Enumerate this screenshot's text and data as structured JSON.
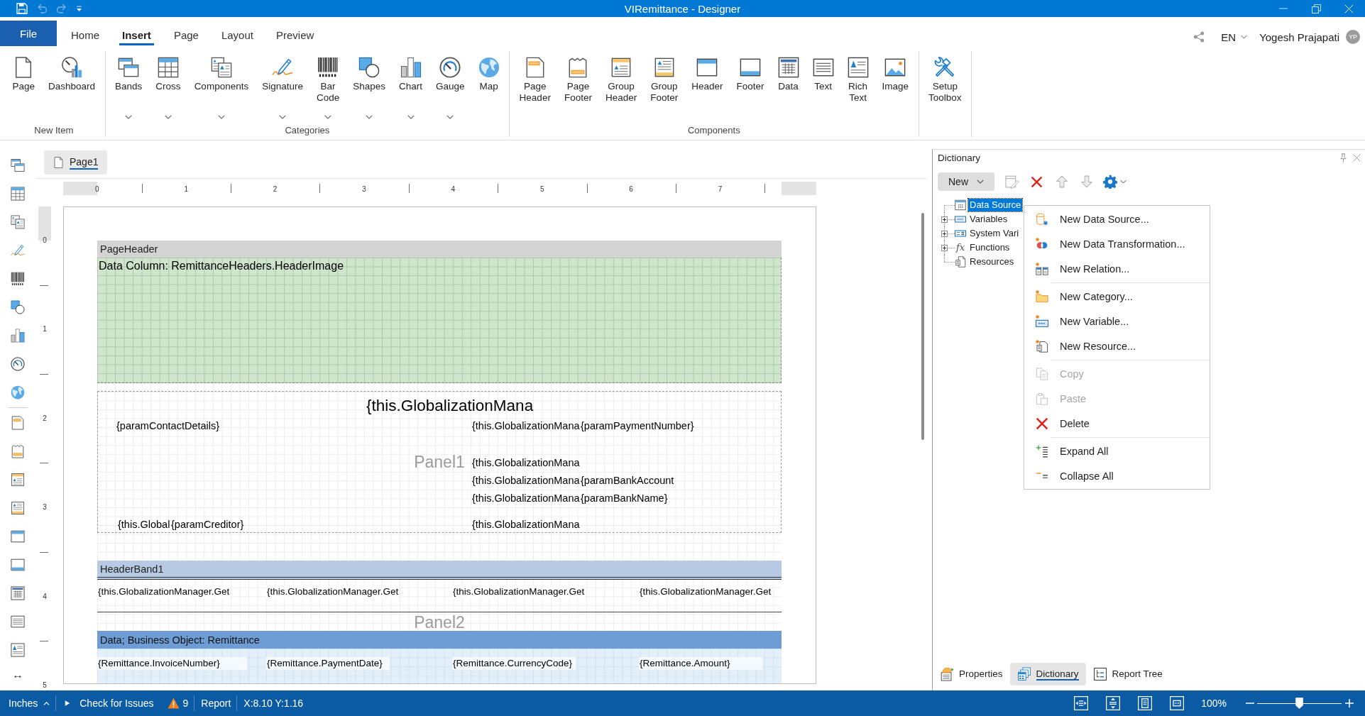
{
  "window": {
    "title": "VIRemittance - Designer",
    "quick_access": [
      {
        "disabled": false
      },
      {
        "disabled": true
      },
      {
        "disabled": true
      }
    ]
  },
  "ribbon": {
    "file_label": "File",
    "tabs": [
      {
        "label": "Home",
        "selected": false
      },
      {
        "label": "Insert",
        "selected": true
      },
      {
        "label": "Page",
        "selected": false
      },
      {
        "label": "Layout",
        "selected": false
      },
      {
        "label": "Preview",
        "selected": false
      }
    ],
    "language": "EN",
    "user": "Yogesh Prajapati",
    "avatar": "YP",
    "groups": [
      {
        "label": "New Item",
        "items": [
          {
            "label": "Page",
            "dropdown": false
          },
          {
            "label": "Dashboard",
            "dropdown": false
          }
        ]
      },
      {
        "label": "Categories",
        "items": [
          {
            "label": "Bands",
            "dropdown": true
          },
          {
            "label": "Cross",
            "dropdown": true
          },
          {
            "label": "Components",
            "dropdown": true
          },
          {
            "label": "Signature",
            "dropdown": true
          },
          {
            "label": "Bar Code",
            "dropdown": true
          },
          {
            "label": "Shapes",
            "dropdown": true
          },
          {
            "label": "Chart",
            "dropdown": true
          },
          {
            "label": "Gauge",
            "dropdown": true
          },
          {
            "label": "Map",
            "dropdown": false
          }
        ]
      },
      {
        "label": "Components",
        "items": [
          {
            "label": "Page Header",
            "dropdown": false
          },
          {
            "label": "Page Footer",
            "dropdown": false
          },
          {
            "label": "Group Header",
            "dropdown": false
          },
          {
            "label": "Group Footer",
            "dropdown": false
          },
          {
            "label": "Header",
            "dropdown": false
          },
          {
            "label": "Footer",
            "dropdown": false
          },
          {
            "label": "Data",
            "dropdown": false
          },
          {
            "label": "Text",
            "dropdown": false
          },
          {
            "label": "Rich Text",
            "dropdown": false
          },
          {
            "label": "Image",
            "dropdown": false
          }
        ]
      },
      {
        "items": [
          {
            "label": "Setup Toolbox",
            "dropdown": false
          }
        ]
      }
    ]
  },
  "page_tabs": [
    {
      "label": "Page1",
      "selected": true
    }
  ],
  "rulers": {
    "horizontal": [
      "0",
      "1",
      "2",
      "3",
      "4",
      "5",
      "6",
      "7"
    ],
    "vertical": [
      "0",
      "1",
      "2",
      "3",
      "4",
      "5"
    ]
  },
  "report": {
    "bands": [
      {
        "kind": "page_header",
        "title": "PageHeader",
        "content": "Data Column: RemittanceHeaders.HeaderImage"
      },
      {
        "kind": "panel",
        "title": "Panel1",
        "components": [
          "{this.GlobalizationMana",
          "{paramContactDetails}",
          "{this.GlobalizationMana",
          "{paramPaymentNumber}",
          "{this.GlobalizationMana",
          "{this.GlobalizationMana",
          "{paramBankAccount",
          "{this.GlobalizationMana",
          "{paramBankName}",
          "{this.Global",
          "{paramCreditor}",
          "{this.GlobalizationMana"
        ]
      },
      {
        "kind": "panel",
        "title": "Panel2",
        "bands": [
          {
            "kind": "header",
            "title": "HeaderBand1",
            "components": [
              "{this.GlobalizationManager.Get",
              "{this.GlobalizationManager.Get",
              "{this.GlobalizationManager.Get",
              "{this.GlobalizationManager.Get"
            ]
          },
          {
            "kind": "data",
            "title": "Data; Business Object: Remittance",
            "components": [
              "{Remittance.InvoiceNumber}",
              "{Remittance.PaymentDate}",
              "{Remittance.CurrencyCode}",
              "{Remittance.Amount}"
            ]
          }
        ]
      }
    ]
  },
  "dictionary": {
    "title": "Dictionary",
    "new_button": "New",
    "tools": [
      {
        "disabled": true
      },
      {
        "disabled": false
      },
      {
        "disabled": true
      },
      {
        "disabled": true
      },
      {
        "disabled": false
      }
    ],
    "tree": [
      {
        "label": "Data Source",
        "selected": true
      },
      {
        "label": "Variables",
        "selected": false,
        "expanded": false
      },
      {
        "label": "System Vari",
        "selected": false,
        "expanded": false
      },
      {
        "label": "Functions",
        "selected": false,
        "expanded": false,
        "glyph": "fx"
      },
      {
        "label": "Resources",
        "selected": false
      }
    ],
    "context_menu": {
      "sections": [
        {
          "items": [
            {
              "label": "New Data Source...",
              "disabled": false
            },
            {
              "label": "New Data Transformation...",
              "disabled": false
            },
            {
              "label": "New Relation...",
              "disabled": false
            }
          ]
        },
        {
          "items": [
            {
              "label": "New Category...",
              "disabled": false
            },
            {
              "label": "New Variable...",
              "disabled": false
            },
            {
              "label": "New Resource...",
              "disabled": false
            }
          ]
        },
        {
          "items": [
            {
              "label": "Copy",
              "disabled": true
            },
            {
              "label": "Paste",
              "disabled": true
            },
            {
              "label": "Delete",
              "disabled": false
            }
          ]
        },
        {
          "items": [
            {
              "label": "Expand All",
              "disabled": false
            },
            {
              "label": "Collapse All",
              "disabled": false
            }
          ]
        }
      ]
    },
    "panel_tabs": [
      {
        "label": "Properties",
        "selected": false
      },
      {
        "label": "Dictionary",
        "selected": true
      },
      {
        "label": "Report Tree",
        "selected": false
      }
    ]
  },
  "status_bar": {
    "units": "Inches",
    "check_issues": "Check for Issues",
    "issue_count": "9",
    "report": "Report",
    "cursor": "X:8.10 Y:1.16",
    "zoom_label": "100%",
    "zoom": {
      "level": 0.5
    }
  }
}
